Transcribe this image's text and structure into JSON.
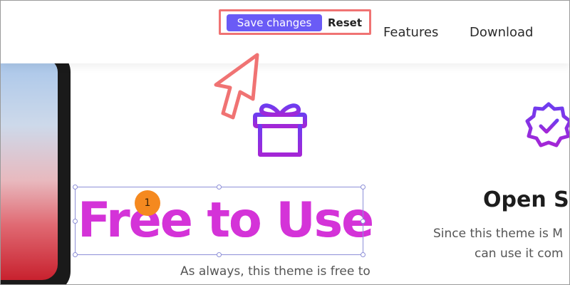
{
  "editor_toolbar": {
    "save_label": "Save changes",
    "reset_label": "Reset"
  },
  "nav": {
    "features_label": "Features",
    "download_label": "Download"
  },
  "feature_free": {
    "title": "Free to Use",
    "step_number": "1",
    "description": "As always, this theme is free to"
  },
  "feature_open_source": {
    "title": "Open So",
    "line1": "Since this theme is M",
    "line2": "can use it com"
  },
  "colors": {
    "save_button": "#6a5bf6",
    "highlight_border": "#f07373",
    "heading_gradient_start": "#e13fd2",
    "icon_gradient_top": "#6d3df0",
    "icon_gradient_bottom": "#a426d6",
    "step_badge": "#f5891f"
  },
  "icons": [
    "gift-icon",
    "verified-badge-icon",
    "cursor-arrow-icon"
  ]
}
